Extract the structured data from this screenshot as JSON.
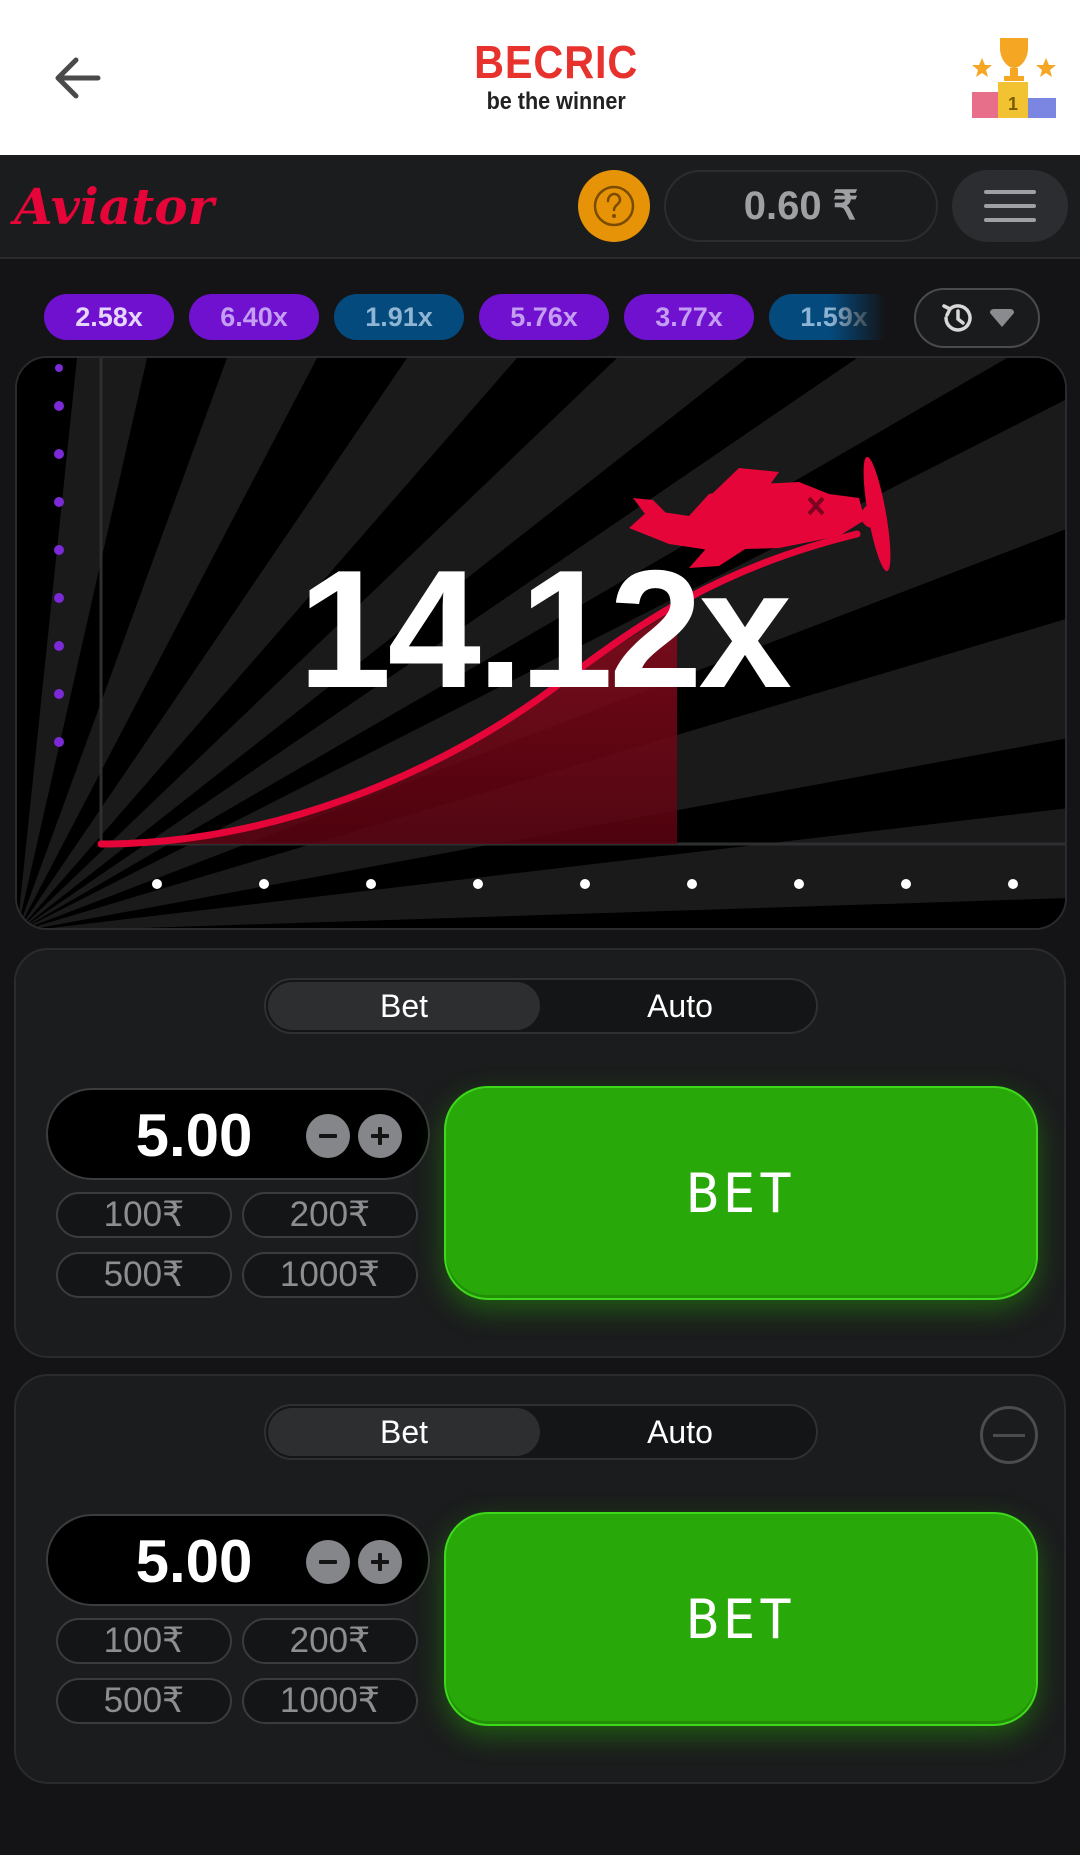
{
  "header": {
    "brand_name": "BECRIC",
    "brand_tagline": "be the winner",
    "back_icon": "arrow-left-icon",
    "trophy_icon": "trophy-podium-icon"
  },
  "game_header": {
    "logo_text": "Aviator",
    "help_icon": "question-icon",
    "balance": "0.60 ₹",
    "menu_icon": "hamburger-menu-icon"
  },
  "history": {
    "multipliers": [
      "2.58x",
      "6.40x",
      "1.91x",
      "5.76x",
      "3.77x",
      "1.59x"
    ],
    "history_icon": "history-icon",
    "dropdown_icon": "chevron-down-icon"
  },
  "game": {
    "multiplier": "14.12x",
    "plane_icon": "airplane-icon"
  },
  "bet_panels": [
    {
      "tabs": [
        "Bet",
        "Auto"
      ],
      "amount": "5.00",
      "quick_amounts": [
        "100₹",
        "200₹",
        "500₹",
        "1000₹"
      ],
      "bet_label": "BET"
    },
    {
      "tabs": [
        "Bet",
        "Auto"
      ],
      "amount": "5.00",
      "quick_amounts": [
        "100₹",
        "200₹",
        "500₹",
        "1000₹"
      ],
      "bet_label": "BET",
      "remove_icon": "minus-circle-icon"
    }
  ],
  "colors": {
    "brand_red": "#e8322d",
    "aviator_red": "#e50539",
    "bet_green": "#28a909",
    "chip_purple": "#7011d0",
    "chip_blue": "#044a7d",
    "help_orange": "#e69308"
  }
}
